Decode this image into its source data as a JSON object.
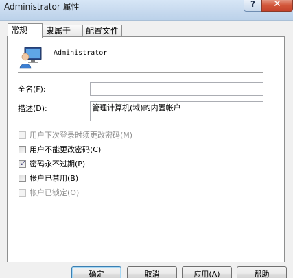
{
  "window": {
    "title": "Administrator 属性",
    "help_glyph": "?",
    "close_glyph": "✕"
  },
  "tabs": [
    {
      "label": "常规",
      "active": true
    },
    {
      "label": "隶属于",
      "active": false
    },
    {
      "label": "配置文件",
      "active": false
    }
  ],
  "general": {
    "user_icon": "user-monitor-icon",
    "username": "Administrator",
    "fullname_label": "全名(F):",
    "fullname_value": "",
    "description_label": "描述(D):",
    "description_value": "管理计算机(域)的内置帐户"
  },
  "options": [
    {
      "label": "用户下次登录时须更改密码(M)",
      "checked": false,
      "disabled": true
    },
    {
      "label": "用户不能更改密码(C)",
      "checked": false,
      "disabled": false
    },
    {
      "label": "密码永不过期(P)",
      "checked": true,
      "disabled": false
    },
    {
      "label": "帐户已禁用(B)",
      "checked": false,
      "disabled": false
    },
    {
      "label": "帐户已锁定(O)",
      "checked": false,
      "disabled": true
    }
  ],
  "buttons": {
    "ok": "确定",
    "cancel": "取消",
    "apply": "应用(A)",
    "help": "帮助"
  },
  "colors": {
    "accent": "#3c7fb1",
    "close": "#d2563a"
  }
}
